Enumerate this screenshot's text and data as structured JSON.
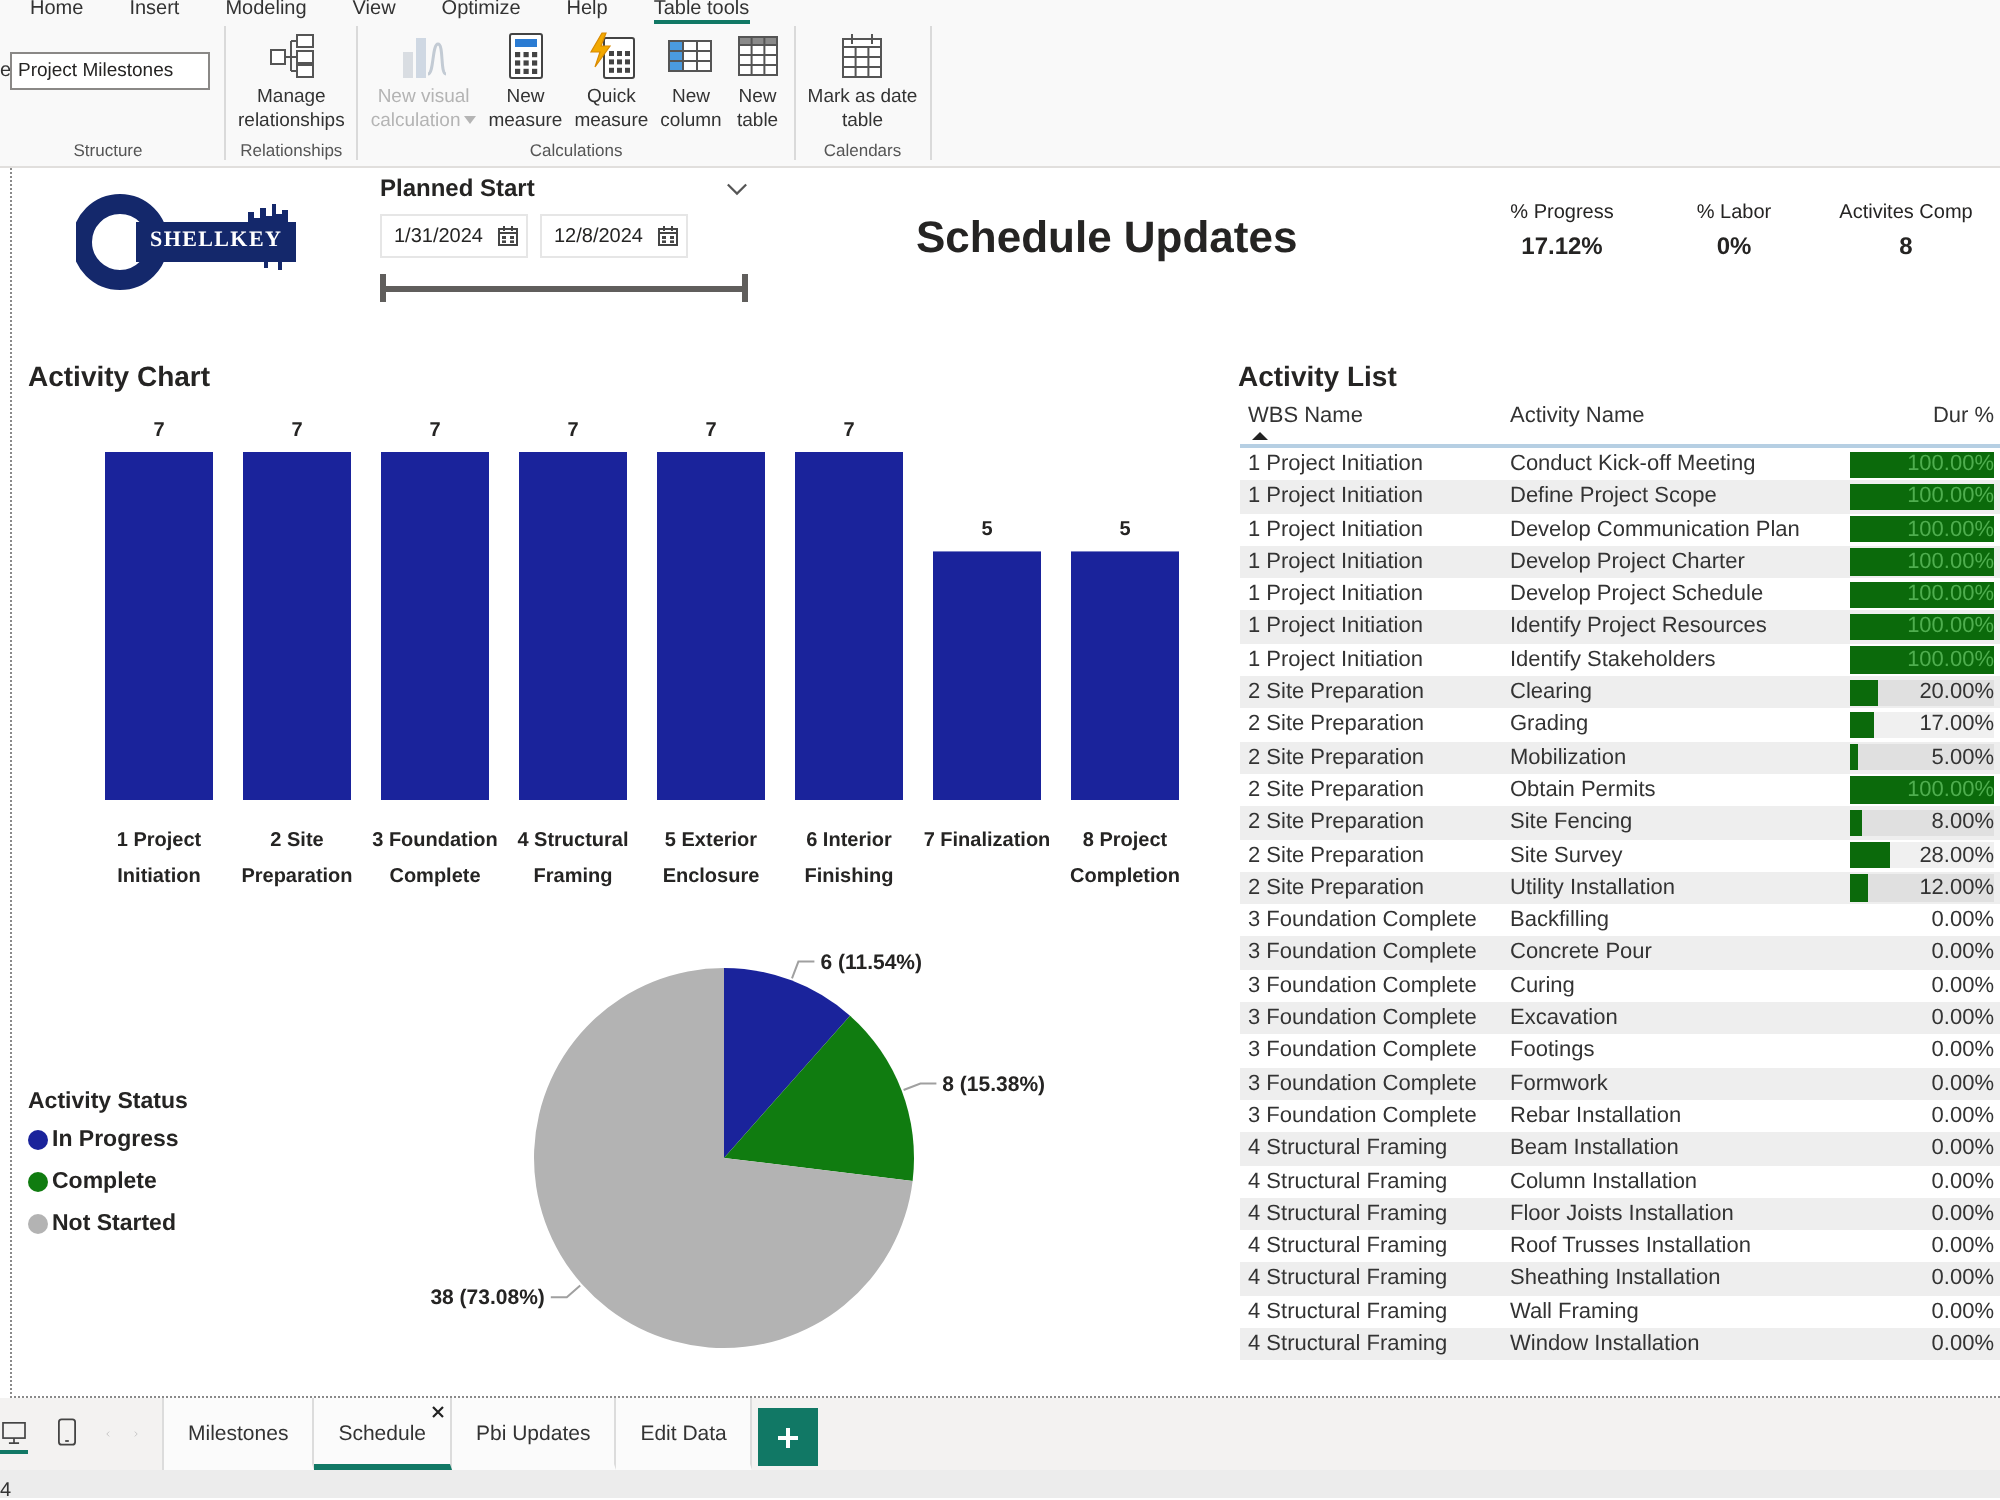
{
  "menu_tabs": [
    {
      "label": "Home",
      "selected": false
    },
    {
      "label": "Insert",
      "selected": false
    },
    {
      "label": "Modeling",
      "selected": false
    },
    {
      "label": "View",
      "selected": false
    },
    {
      "label": "Optimize",
      "selected": false
    },
    {
      "label": "Help",
      "selected": false
    },
    {
      "label": "Table tools",
      "selected": true
    }
  ],
  "ribbon": {
    "groups": [
      {
        "kind": "name-field",
        "label": "Structure",
        "name_label": "e",
        "field_value": "Project Milestones"
      },
      {
        "kind": "buttons",
        "label": "Relationships",
        "buttons": [
          {
            "kind": "relationships",
            "label": "Manage\nrelationships",
            "disabled": false,
            "dropdown": false
          }
        ]
      },
      {
        "kind": "buttons",
        "label": "Calculations",
        "buttons": [
          {
            "kind": "visual-calc",
            "label": "New visual\ncalculation",
            "disabled": true,
            "dropdown": true
          },
          {
            "kind": "measure",
            "label": "New\nmeasure",
            "disabled": false,
            "dropdown": false
          },
          {
            "kind": "quick-measure",
            "label": "Quick\nmeasure",
            "disabled": false,
            "dropdown": false
          },
          {
            "kind": "column",
            "label": "New\ncolumn",
            "disabled": false,
            "dropdown": false
          },
          {
            "kind": "table",
            "label": "New\ntable",
            "disabled": false,
            "dropdown": false
          }
        ]
      },
      {
        "kind": "buttons",
        "label": "Calendars",
        "buttons": [
          {
            "kind": "date-table",
            "label": "Mark as date\ntable",
            "disabled": false,
            "dropdown": false
          }
        ]
      }
    ]
  },
  "logo": {
    "text": "SHELLKEY"
  },
  "planned_start": {
    "title": "Planned Start",
    "start_date": "1/31/2024",
    "end_date": "12/8/2024",
    "slider": {
      "level": 1
    }
  },
  "title": "Schedule Updates",
  "kpis": [
    {
      "label": "% Progress",
      "value": "17.12%"
    },
    {
      "label": "% Labor",
      "value": "0%"
    },
    {
      "label": "Activites Comp",
      "value": "8"
    }
  ],
  "activity_chart": {
    "title": "Activity Chart",
    "chart_data": {
      "type": "bar",
      "categories": [
        "1 Project Initiation",
        "2 Site Preparation",
        "3 Foundation Complete",
        "4 Structural Framing",
        "5 Exterior Enclosure",
        "6 Interior Finishing",
        "7 Finalization",
        "8 Project Completion"
      ],
      "series": [
        {
          "color": "#1a239b",
          "values": [
            7,
            7,
            7,
            7,
            7,
            7,
            5,
            5
          ]
        }
      ],
      "data_labels": true
    }
  },
  "status_chart": {
    "legend_title": "Activity Status",
    "slices": [
      {
        "color": "#1a239b"
      },
      {
        "color": "#107c10"
      },
      {
        "color": "#b3b3b3"
      }
    ],
    "chart_data": {
      "type": "pie",
      "categories": [
        "In Progress",
        "Complete",
        "Not Started"
      ],
      "values": [
        6,
        8,
        38
      ],
      "value_labels": [
        "6 (11.54%)",
        "8 (15.38%)",
        "38 (73.08%)"
      ]
    }
  },
  "activity_list": {
    "title": "Activity List",
    "columns": [
      {
        "label": "WBS Name",
        "sorted": true
      },
      {
        "label": "Activity Name",
        "sorted": false
      },
      {
        "label": "Dur %",
        "sorted": false
      }
    ],
    "rows": [
      {
        "wbs": "1 Project Initiation",
        "activity": "Conduct Kick-off Meeting",
        "dur": "100.00%",
        "level": 1
      },
      {
        "wbs": "1 Project Initiation",
        "activity": "Define Project Scope",
        "dur": "100.00%",
        "level": 1
      },
      {
        "wbs": "1 Project Initiation",
        "activity": "Develop Communication Plan",
        "dur": "100.00%",
        "level": 1
      },
      {
        "wbs": "1 Project Initiation",
        "activity": "Develop Project Charter",
        "dur": "100.00%",
        "level": 1
      },
      {
        "wbs": "1 Project Initiation",
        "activity": "Develop Project Schedule",
        "dur": "100.00%",
        "level": 1
      },
      {
        "wbs": "1 Project Initiation",
        "activity": "Identify Project Resources",
        "dur": "100.00%",
        "level": 1
      },
      {
        "wbs": "1 Project Initiation",
        "activity": "Identify Stakeholders",
        "dur": "100.00%",
        "level": 1
      },
      {
        "wbs": "2 Site Preparation",
        "activity": "Clearing",
        "dur": "20.00%",
        "level": 0.2
      },
      {
        "wbs": "2 Site Preparation",
        "activity": "Grading",
        "dur": "17.00%",
        "level": 0.17
      },
      {
        "wbs": "2 Site Preparation",
        "activity": "Mobilization",
        "dur": "5.00%",
        "level": 0.05
      },
      {
        "wbs": "2 Site Preparation",
        "activity": "Obtain Permits",
        "dur": "100.00%",
        "level": 1
      },
      {
        "wbs": "2 Site Preparation",
        "activity": "Site Fencing",
        "dur": "8.00%",
        "level": 0.08
      },
      {
        "wbs": "2 Site Preparation",
        "activity": "Site Survey",
        "dur": "28.00%",
        "level": 0.28
      },
      {
        "wbs": "2 Site Preparation",
        "activity": "Utility Installation",
        "dur": "12.00%",
        "level": 0.12
      },
      {
        "wbs": "3 Foundation Complete",
        "activity": "Backfilling",
        "dur": "0.00%"
      },
      {
        "wbs": "3 Foundation Complete",
        "activity": "Concrete Pour",
        "dur": "0.00%"
      },
      {
        "wbs": "3 Foundation Complete",
        "activity": "Curing",
        "dur": "0.00%"
      },
      {
        "wbs": "3 Foundation Complete",
        "activity": "Excavation",
        "dur": "0.00%"
      },
      {
        "wbs": "3 Foundation Complete",
        "activity": "Footings",
        "dur": "0.00%"
      },
      {
        "wbs": "3 Foundation Complete",
        "activity": "Formwork",
        "dur": "0.00%"
      },
      {
        "wbs": "3 Foundation Complete",
        "activity": "Rebar Installation",
        "dur": "0.00%"
      },
      {
        "wbs": "4 Structural Framing",
        "activity": "Beam Installation",
        "dur": "0.00%"
      },
      {
        "wbs": "4 Structural Framing",
        "activity": "Column Installation",
        "dur": "0.00%"
      },
      {
        "wbs": "4 Structural Framing",
        "activity": "Floor Joists Installation",
        "dur": "0.00%"
      },
      {
        "wbs": "4 Structural Framing",
        "activity": "Roof Trusses Installation",
        "dur": "0.00%"
      },
      {
        "wbs": "4 Structural Framing",
        "activity": "Sheathing Installation",
        "dur": "0.00%"
      },
      {
        "wbs": "4 Structural Framing",
        "activity": "Wall Framing",
        "dur": "0.00%"
      },
      {
        "wbs": "4 Structural Framing",
        "activity": "Window Installation",
        "dur": "0.00%"
      }
    ]
  },
  "views": [
    {
      "kind": "desktop",
      "selected": true
    },
    {
      "kind": "mobile",
      "selected": false
    }
  ],
  "page_tabs": [
    {
      "label": "Milestones",
      "selected": false
    },
    {
      "label": "Schedule",
      "selected": true
    },
    {
      "label": "Pbi Updates",
      "selected": false
    },
    {
      "label": "Edit Data",
      "selected": false
    }
  ],
  "status_bar": {
    "text": "4"
  }
}
